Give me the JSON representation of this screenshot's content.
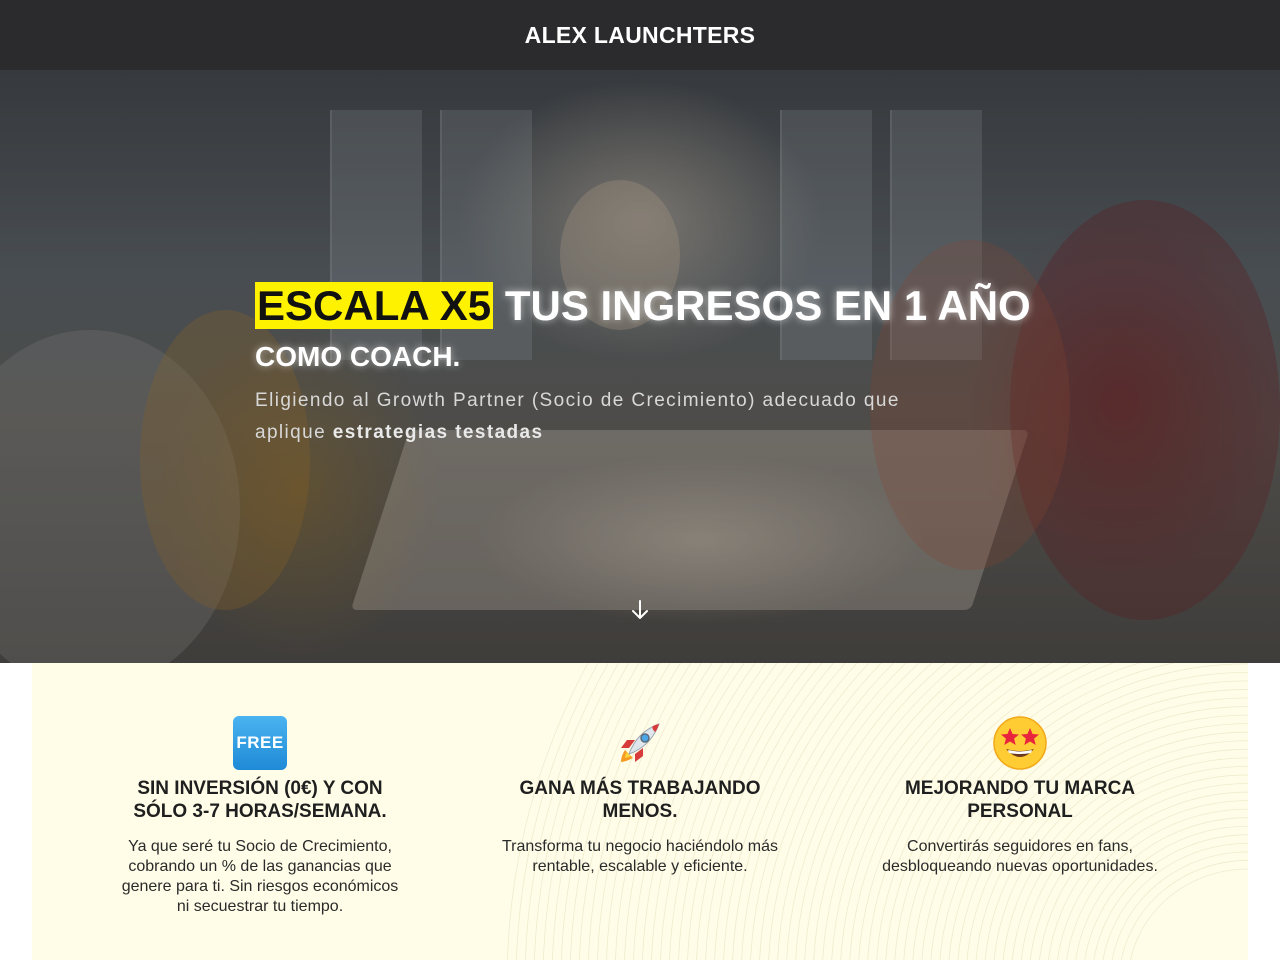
{
  "header": {
    "brand": "ALEX LAUNCHTERS"
  },
  "hero": {
    "headline_highlight": "ESCALA X5",
    "headline_rest": " TUS INGRESOS EN 1 AÑO",
    "headline_line2": "COMO COACH.",
    "subtitle_text": "Eligiendo al Growth Partner (Socio de Crecimiento) adecuado que aplique ",
    "subtitle_bold": "estrategias testadas",
    "highlight_color": "#fff200",
    "scroll_icon": "arrow-down-icon"
  },
  "features": [
    {
      "icon": "free-badge-icon",
      "icon_text": "FREE",
      "title": "SIN INVERSIÓN (0€) Y CON SÓLO 3-7 HORAS/SEMANA.",
      "desc": "Ya que seré tu Socio de Crecimiento, cobrando un % de las ganancias que genere para ti. Sin riesgos económicos ni secuestrar tu tiempo."
    },
    {
      "icon": "rocket-icon",
      "title": "GANA MÁS TRABAJANDO MENOS.",
      "desc": "Transforma tu negocio haciéndolo más rentable, escalable y eficiente."
    },
    {
      "icon": "star-struck-face-icon",
      "title": "MEJORANDO TU MARCA PERSONAL",
      "desc": "Convertirás seguidores en fans, desbloqueando nuevas oportunidades."
    }
  ],
  "colors": {
    "topbar": "#2b2b2d",
    "features_bg": "#fffde8"
  }
}
